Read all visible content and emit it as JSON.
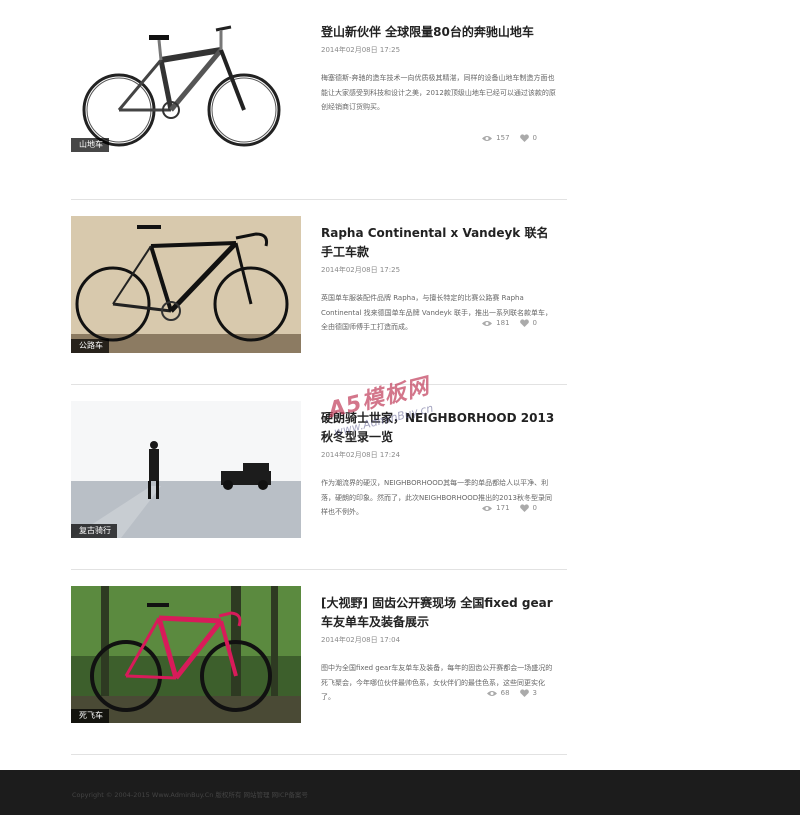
{
  "posts": [
    {
      "title": "登山新伙伴 全球限量80台的奔驰山地车",
      "date": "2014年02月08日 17:25",
      "excerpt": "梅塞德斯-奔驰的造车技术一向优质极其精湛，同样的设备山地车制造方面也能让大家感受到科技和设计之美，2012款顶级山地车已经可以通过该款的原创经销商订货购买。",
      "tag": "山地车",
      "views": "157",
      "likes": "0",
      "image_icon": "mountain-bike-photo"
    },
    {
      "title": "Rapha Continental x Vandeyk 联名手工车款",
      "date": "2014年02月08日 17:25",
      "excerpt": "英国单车服装配件品牌 Rapha，与擅长特定的比赛公路赛 Rapha Continental 找来德国单车品牌 Vandeyk 联手，推出一系列联名款单车，全由德国师傅手工打造而成。",
      "tag": "公路车",
      "views": "181",
      "likes": "0",
      "image_icon": "road-bike-photo"
    },
    {
      "title": "硬朗骑士世家，NEIGHBORHOOD 2013秋冬型录一览",
      "date": "2014年02月08日 17:24",
      "excerpt": "作为潮流界的硬汉，NEIGHBORHOOD其每一季的单品都给人以平净、利落，硬朗的印象。然而了，此次NEIGHBORHOOD推出的2013秋冬型录同样也不例外。",
      "tag": "复古骑行",
      "views": "171",
      "likes": "0",
      "image_icon": "vintage-car-photo"
    },
    {
      "title": "[大视野] 固齿公开赛现场 全国fixed gear车友单车及装备展示",
      "date": "2014年02月08日 17:04",
      "excerpt": "图中为全国fixed gear车友单车及装备，每年的固齿公开赛都会一场盛况的死飞聚会，今年哪位伙伴最帅色系，女伙伴们的最佳色系，这些同更实化了。",
      "tag": "死飞车",
      "views": "68",
      "likes": "3",
      "image_icon": "fixed-gear-bike-photo"
    }
  ],
  "watermark": {
    "line1": "A5模板网",
    "line2": "www.AdminBuy.cn"
  },
  "footer": {
    "text": "Copyright © 2004-2015 Www.AdminBuy.Cn 版权所有 网站管理 网ICP备案号"
  },
  "colors": {
    "footer_bg": "#1c1c1c",
    "tag_bg": "#000000",
    "divider": "#e2e2e2",
    "bike_pink": "#d81b5a"
  }
}
